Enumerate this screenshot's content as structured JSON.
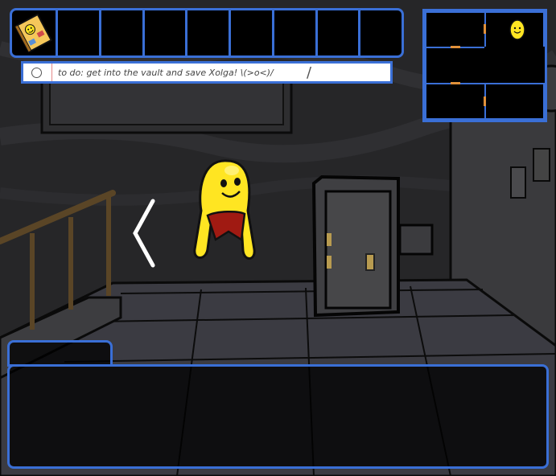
{
  "todo": {
    "text": "to do: get into the vault and save Xolga!  \\(>o<)/"
  },
  "inventory": {
    "slot_count": 9,
    "items": [
      {
        "name": "notebook-with-smiley-sticker",
        "slot": 0
      }
    ]
  },
  "map": {
    "current_room_character": "yellow-blob",
    "rooms": 6
  },
  "dialog": {
    "speaker": "",
    "text": ""
  },
  "colors": {
    "ui_border": "#3a6fd6",
    "door_marker": "#e0913a",
    "character": "#ffe522",
    "scarf": "#a01a12"
  }
}
